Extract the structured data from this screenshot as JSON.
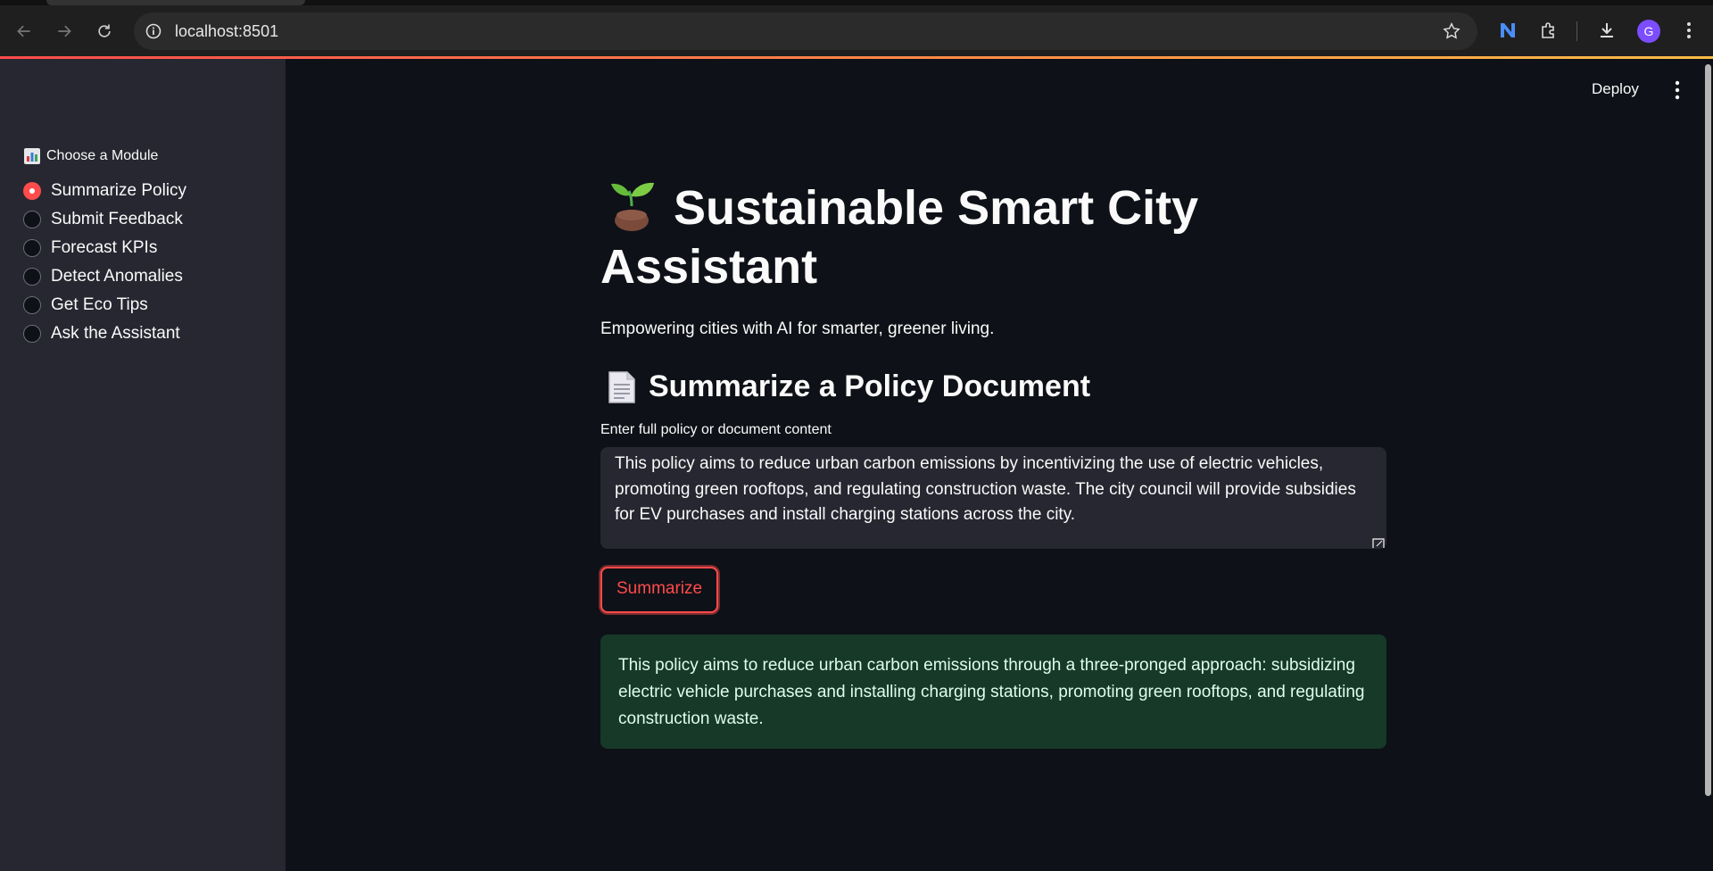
{
  "browser": {
    "url": "localhost:8501",
    "profile_initial": "G",
    "icons": [
      "back-icon",
      "forward-icon",
      "reload-icon",
      "site-info-icon",
      "bookmark-star-icon",
      "extension-n-icon",
      "extensions-puzzle-icon",
      "download-icon",
      "menu-kebab-icon"
    ]
  },
  "app": {
    "deploy_label": "Deploy"
  },
  "sidebar": {
    "module_label": "Choose a Module",
    "options": [
      {
        "label": "Summarize Policy",
        "selected": true
      },
      {
        "label": "Submit Feedback",
        "selected": false
      },
      {
        "label": "Forecast KPIs",
        "selected": false
      },
      {
        "label": "Detect Anomalies",
        "selected": false
      },
      {
        "label": "Get Eco Tips",
        "selected": false
      },
      {
        "label": "Ask the Assistant",
        "selected": false
      }
    ]
  },
  "main": {
    "title": "Sustainable Smart City Assistant",
    "subtitle": "Empowering cities with AI for smarter, greener living.",
    "section_title": "Summarize a Policy Document",
    "input_label": "Enter full policy or document content",
    "input_value": "This policy aims to reduce urban carbon emissions by incentivizing the use of electric vehicles, promoting green rooftops, and regulating construction waste. The city council will provide subsidies for EV purchases and install charging stations across the city.",
    "button_label": "Summarize",
    "result_text": "This policy aims to reduce urban carbon emissions through a three-pronged approach: subsidizing electric vehicle purchases and installing charging stations, promoting green rooftops, and regulating construction waste."
  },
  "colors": {
    "accent": "#ff4b4b",
    "sidebar_bg": "#262730",
    "main_bg": "#0e1117",
    "success_bg": "#173928"
  }
}
